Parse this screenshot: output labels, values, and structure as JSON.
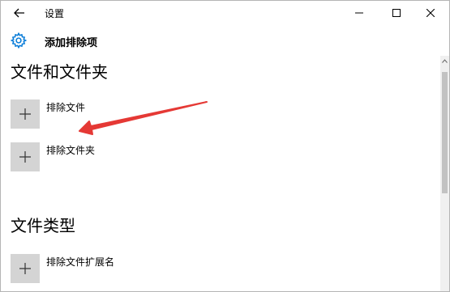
{
  "window": {
    "title": "设置",
    "back_icon": "back-arrow-icon",
    "minimize_icon": "minimize-icon",
    "maximize_icon": "maximize-icon",
    "close_icon": "close-icon"
  },
  "header": {
    "icon": "gear-icon",
    "title": "添加排除项"
  },
  "sections": [
    {
      "title": "文件和文件夹",
      "items": [
        {
          "label": "排除文件",
          "icon": "plus-icon"
        },
        {
          "label": "排除文件夹",
          "icon": "plus-icon"
        }
      ]
    },
    {
      "title": "文件类型",
      "items": [
        {
          "label": "排除文件扩展名",
          "icon": "plus-icon"
        }
      ]
    }
  ],
  "colors": {
    "annotation_arrow": "#e53935",
    "plus_box": "#d4d4d4",
    "gear": "#0078d7"
  }
}
